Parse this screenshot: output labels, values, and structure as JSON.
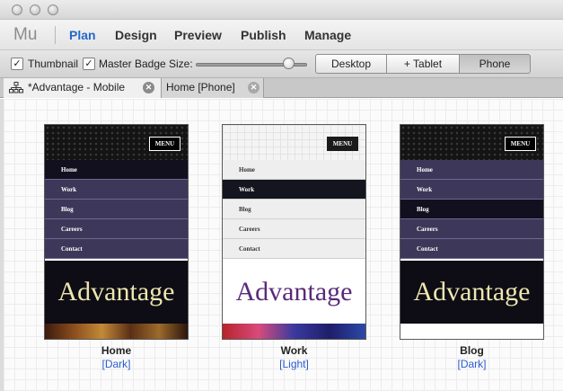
{
  "app": {
    "logo": "Mu"
  },
  "menu": {
    "items": [
      "Plan",
      "Design",
      "Preview",
      "Publish",
      "Manage"
    ],
    "active": "Plan"
  },
  "toolbar": {
    "thumbnail_label": "Thumbnail",
    "thumbnail_checked": true,
    "master_badge_label": "Master Badge",
    "master_badge_checked": true,
    "size_label": "Size:",
    "size_value_percent": 78,
    "views": [
      "Desktop",
      "+ Tablet",
      "Phone"
    ],
    "selected_view": "Phone"
  },
  "tabs": [
    {
      "label": "*Advantage - Mobile",
      "icon": "sitemap-icon",
      "active": true
    },
    {
      "label": "Home [Phone]",
      "active": false
    }
  ],
  "pages": [
    {
      "name": "Home",
      "master": "[Dark]",
      "theme": "dark",
      "menu_button": "MENU",
      "nav": [
        "Home",
        "Work",
        "Blog",
        "Careers",
        "Contact"
      ],
      "current": "Home",
      "brand": "Advantage",
      "photo": "warm"
    },
    {
      "name": "Work",
      "master": "[Light]",
      "theme": "light",
      "menu_button": "MENU",
      "nav": [
        "Home",
        "Work",
        "Blog",
        "Careers",
        "Contact"
      ],
      "current": "Work",
      "brand": "Advantage",
      "photo": "cool"
    },
    {
      "name": "Blog",
      "master": "[Dark]",
      "theme": "dark",
      "menu_button": "MENU",
      "nav": [
        "Home",
        "Work",
        "Blog",
        "Careers",
        "Contact"
      ],
      "current": "Blog",
      "brand": "Advantage",
      "photo": "blank"
    }
  ],
  "colors": {
    "accent": "#2468c9",
    "master_link": "#2a5bd0"
  }
}
